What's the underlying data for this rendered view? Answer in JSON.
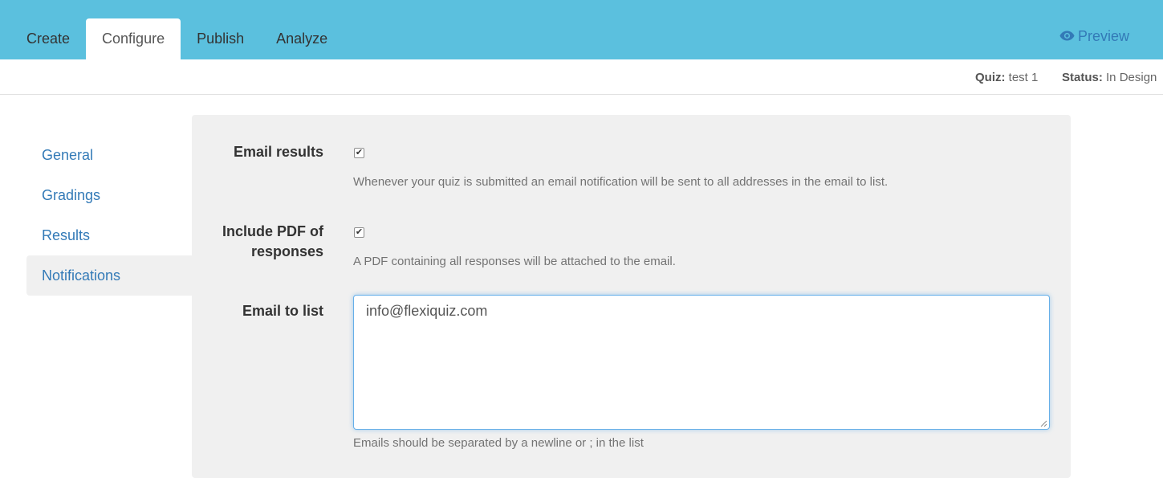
{
  "tabs": [
    {
      "label": "Create",
      "active": false
    },
    {
      "label": "Configure",
      "active": true
    },
    {
      "label": "Publish",
      "active": false
    },
    {
      "label": "Analyze",
      "active": false
    }
  ],
  "preview_label": "Preview",
  "status_bar": {
    "quiz_label": "Quiz:",
    "quiz_value": "test 1",
    "status_label": "Status:",
    "status_value": "In Design"
  },
  "sidenav": [
    {
      "label": "General",
      "active": false
    },
    {
      "label": "Gradings",
      "active": false
    },
    {
      "label": "Results",
      "active": false
    },
    {
      "label": "Notifications",
      "active": true
    }
  ],
  "form": {
    "email_results": {
      "label": "Email results",
      "checked": true,
      "help": "Whenever your quiz is submitted an email notification will be sent to all addresses in the email to list."
    },
    "include_pdf": {
      "label_line1": "Include PDF of",
      "label_line2": "responses",
      "checked": true,
      "help": "A PDF containing all responses will be attached to the email."
    },
    "email_list": {
      "label": "Email to list",
      "value": "info@flexiquiz.com",
      "help": "Emails should be separated by a newline or ; in the list"
    }
  },
  "colors": {
    "topbar": "#5bc0de",
    "link": "#337ab7",
    "panel": "#f0f0f0"
  }
}
